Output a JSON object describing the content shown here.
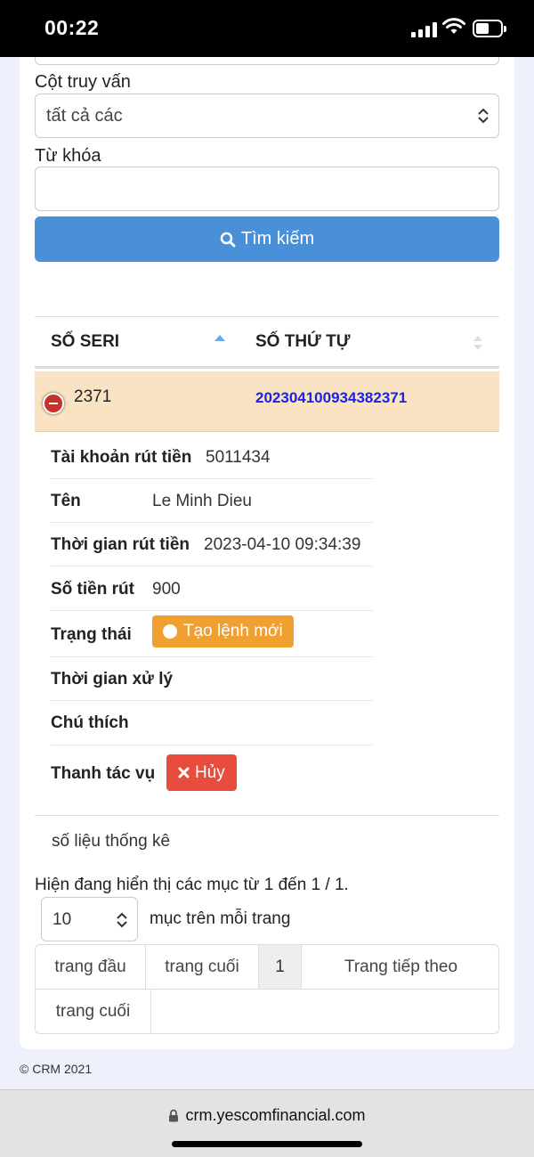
{
  "status_bar": {
    "time": "00:22"
  },
  "form": {
    "query_column_label": "Cột truy vấn",
    "query_column_value": "tất cả các",
    "keyword_label": "Từ khóa",
    "keyword_value": "",
    "search_button": "Tìm kiếm"
  },
  "table": {
    "headers": [
      "SỐ SERI",
      "SỐ THỨ TỰ"
    ],
    "row": {
      "seri": "2371",
      "order_no": "20230410093438237​1"
    }
  },
  "details": [
    {
      "key": "Tài khoản rút tiền",
      "value": "5011434"
    },
    {
      "key": "Tên",
      "value": "Le Minh Dieu"
    },
    {
      "key": "Thời gian rút tiền",
      "value": "2023-04-10 09:34:39"
    },
    {
      "key": "Số tiền rút",
      "value": "900"
    },
    {
      "key": "Trạng thái",
      "value": "Tạo lệnh mới"
    },
    {
      "key": "Thời gian xử lý",
      "value": ""
    },
    {
      "key": "Chú thích",
      "value": ""
    },
    {
      "key": "Thanh tác vụ",
      "value": "Hủy"
    }
  ],
  "stats_label": "số liệu thống kê",
  "showing_text": "Hiện đang hiển thị các mục từ 1 đến 1 / 1.",
  "per_page": {
    "value": "10",
    "label": "mục trên mỗi trang"
  },
  "pagination": [
    "trang đầu",
    "trang cuối",
    "1",
    "Trang tiếp theo",
    "trang cuối"
  ],
  "footer": "© CRM 2021",
  "browser": {
    "url": "crm.yescomfinancial.com"
  },
  "colors": {
    "primary": "#4a90d9",
    "warning": "#f0a030",
    "danger": "#e74c3c",
    "row_highlight": "#fae3c2",
    "link_blue": "#1a23e6"
  }
}
